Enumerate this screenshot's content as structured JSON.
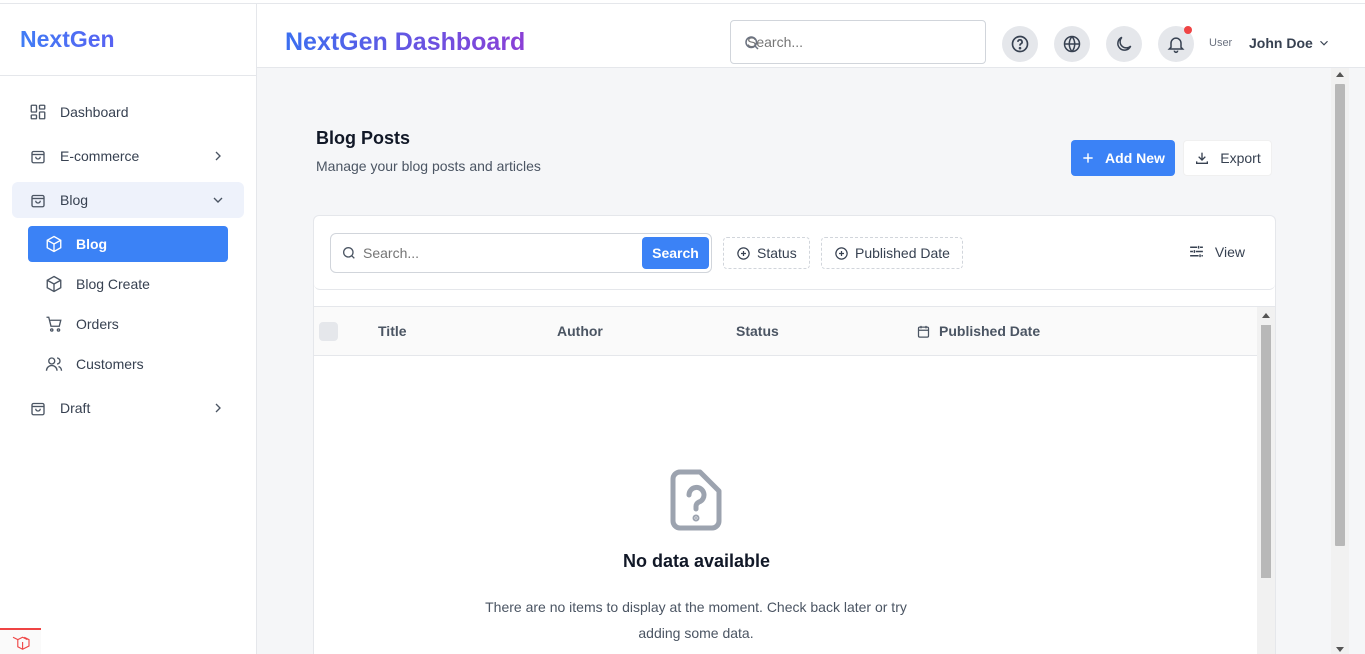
{
  "sidebar": {
    "brand": "NextGen",
    "items": [
      {
        "label": "Dashboard",
        "icon": "dashboard-grid-icon"
      },
      {
        "label": "E-commerce",
        "icon": "shopping-bag-icon"
      },
      {
        "label": "Blog",
        "icon": "shopping-bag-icon"
      },
      {
        "label": "Draft",
        "icon": "shopping-bag-icon"
      }
    ],
    "sub_items": [
      {
        "label": "Blog",
        "icon": "box-icon"
      },
      {
        "label": "Blog Create",
        "icon": "box-icon"
      },
      {
        "label": "Orders",
        "icon": "cart-icon"
      },
      {
        "label": "Customers",
        "icon": "users-icon"
      }
    ]
  },
  "header": {
    "title": "NextGen Dashboard",
    "search_placeholder": "Search...",
    "user_name": "John Doe",
    "avatar_alt": "User"
  },
  "page": {
    "title": "Blog Posts",
    "subtitle": "Manage your blog posts and articles",
    "add_label": "Add New",
    "export_label": "Export"
  },
  "filters": {
    "search_placeholder": "Search...",
    "search_button": "Search",
    "status_label": "Status",
    "published_date_label": "Published Date",
    "view_label": "View"
  },
  "table": {
    "columns": [
      "Title",
      "Author",
      "Status",
      "Published Date"
    ]
  },
  "empty": {
    "title": "No data available",
    "description": "There are no items to display at the moment. Check back later or try adding some data."
  },
  "colors": {
    "accent": "#3b82f6",
    "notification": "#ef4444"
  }
}
